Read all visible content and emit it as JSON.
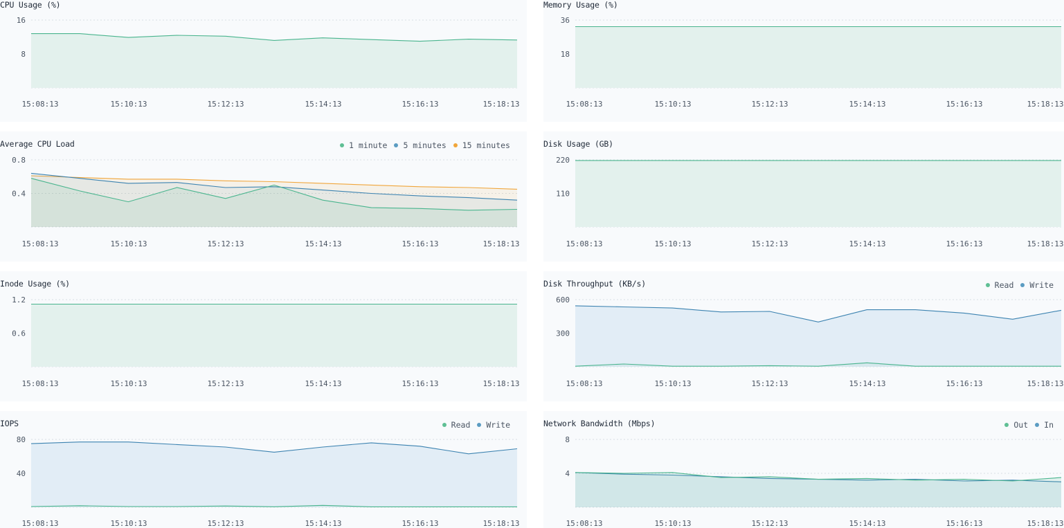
{
  "chart_data": [
    {
      "id": "cpu",
      "type": "area",
      "title": "CPU Usage (%)",
      "yticks": [
        "16",
        "8"
      ],
      "ylim": [
        0,
        16
      ],
      "xticks": [
        "15:08:13",
        "15:10:13",
        "15:12:13",
        "15:14:13",
        "15:16:13",
        "15:18:13"
      ],
      "grid": true,
      "series": [
        {
          "color": "#48b48d",
          "fill": "#e3f1ed",
          "values": [
            12.8,
            12.8,
            11.9,
            12.4,
            12.2,
            11.2,
            11.8,
            11.4,
            11.0,
            11.5,
            11.3
          ]
        }
      ]
    },
    {
      "id": "mem",
      "type": "area",
      "title": "Memory Usage (%)",
      "yticks": [
        "36",
        "18"
      ],
      "ylim": [
        0,
        36
      ],
      "xticks": [
        "15:08:13",
        "15:10:13",
        "15:12:13",
        "15:14:13",
        "15:16:13",
        "15:18:13"
      ],
      "grid": true,
      "series": [
        {
          "color": "#48b48d",
          "fill": "#e3f1ed",
          "values": [
            32.5,
            32.5,
            32.5,
            32.5,
            32.5,
            32.5,
            32.5,
            32.5,
            32.5,
            32.5,
            32.5
          ]
        }
      ]
    },
    {
      "id": "load",
      "type": "area",
      "title": "Average CPU Load",
      "yticks": [
        "0.8",
        "0.4"
      ],
      "ylim": [
        0,
        0.8
      ],
      "xticks": [
        "15:08:13",
        "15:10:13",
        "15:12:13",
        "15:14:13",
        "15:16:13",
        "15:18:13"
      ],
      "grid": true,
      "legend": [
        {
          "label": "1 minute",
          "color": "#5fbf94"
        },
        {
          "label": "5 minutes",
          "color": "#5b9cc2"
        },
        {
          "label": "15 minutes",
          "color": "#f0a53a"
        }
      ],
      "series": [
        {
          "name": "15 minutes",
          "color": "#f0a53a",
          "fill": "rgba(240,165,58,0.10)",
          "values": [
            0.61,
            0.59,
            0.57,
            0.57,
            0.55,
            0.54,
            0.52,
            0.5,
            0.48,
            0.47,
            0.45
          ]
        },
        {
          "name": "5 minutes",
          "color": "#3b82b0",
          "fill": "rgba(91,156,194,0.10)",
          "values": [
            0.64,
            0.58,
            0.52,
            0.53,
            0.47,
            0.48,
            0.44,
            0.4,
            0.37,
            0.35,
            0.32
          ]
        },
        {
          "name": "1 minute",
          "color": "#48b48d",
          "fill": "rgba(72,180,141,0.10)",
          "values": [
            0.58,
            0.43,
            0.3,
            0.47,
            0.34,
            0.5,
            0.32,
            0.23,
            0.22,
            0.2,
            0.21
          ]
        }
      ]
    },
    {
      "id": "disk",
      "type": "area",
      "title": "Disk Usage (GB)",
      "yticks": [
        "220",
        "110"
      ],
      "ylim": [
        0,
        220
      ],
      "xticks": [
        "15:08:13",
        "15:10:13",
        "15:12:13",
        "15:14:13",
        "15:16:13",
        "15:18:13"
      ],
      "grid": true,
      "series": [
        {
          "color": "#48b48d",
          "fill": "#e3f1ed",
          "values": [
            218,
            218,
            218,
            218,
            218,
            218,
            218,
            218,
            218,
            218,
            218
          ]
        }
      ]
    },
    {
      "id": "inode",
      "type": "area",
      "title": "Inode Usage (%)",
      "yticks": [
        "1.2",
        "0.6"
      ],
      "ylim": [
        0,
        1.2
      ],
      "xticks": [
        "15:08:13",
        "15:10:13",
        "15:12:13",
        "15:14:13",
        "15:16:13",
        "15:18:13"
      ],
      "grid": true,
      "series": [
        {
          "color": "#48b48d",
          "fill": "#e3f1ed",
          "values": [
            1.12,
            1.12,
            1.12,
            1.12,
            1.12,
            1.12,
            1.12,
            1.12,
            1.12,
            1.12,
            1.12
          ]
        }
      ]
    },
    {
      "id": "thru",
      "type": "area",
      "title": "Disk Throughput (KB/s)",
      "yticks": [
        "600",
        "300"
      ],
      "ylim": [
        0,
        600
      ],
      "xticks": [
        "15:08:13",
        "15:10:13",
        "15:12:13",
        "15:14:13",
        "15:16:13",
        "15:18:13"
      ],
      "grid": true,
      "legend": [
        {
          "label": "Read",
          "color": "#5fbf94"
        },
        {
          "label": "Write",
          "color": "#5b9cc2"
        }
      ],
      "series": [
        {
          "name": "Write",
          "color": "#3b82b0",
          "fill": "#e2edf6",
          "values": [
            545,
            535,
            525,
            490,
            495,
            400,
            510,
            510,
            480,
            425,
            505
          ]
        },
        {
          "name": "Read",
          "color": "#48b48d",
          "fill": "rgba(72,180,141,0.08)",
          "values": [
            5,
            25,
            5,
            5,
            10,
            5,
            35,
            5,
            5,
            5,
            5
          ]
        }
      ]
    },
    {
      "id": "iops",
      "type": "area",
      "title": "IOPS",
      "yticks": [
        "80",
        "40"
      ],
      "ylim": [
        0,
        80
      ],
      "xticks": [
        "15:08:13",
        "15:10:13",
        "15:12:13",
        "15:14:13",
        "15:16:13",
        "15:18:13"
      ],
      "grid": true,
      "legend": [
        {
          "label": "Read",
          "color": "#5fbf94"
        },
        {
          "label": "Write",
          "color": "#5b9cc2"
        }
      ],
      "series": [
        {
          "name": "Write",
          "color": "#3b82b0",
          "fill": "#e2edf6",
          "values": [
            75,
            77,
            77,
            74,
            71,
            65,
            71,
            76,
            72,
            63,
            69
          ]
        },
        {
          "name": "Read",
          "color": "#48b48d",
          "fill": "rgba(72,180,141,0.08)",
          "values": [
            0.8,
            1.8,
            0.8,
            0.8,
            1.5,
            0.6,
            2.2,
            0.5,
            0.5,
            0.5,
            0.5
          ]
        }
      ]
    },
    {
      "id": "net",
      "type": "area",
      "title": "Network Bandwidth (Mbps)",
      "yticks": [
        "8",
        "4"
      ],
      "ylim": [
        0,
        8
      ],
      "xticks": [
        "15:08:13",
        "15:10:13",
        "15:12:13",
        "15:14:13",
        "15:16:13",
        "15:18:13"
      ],
      "grid": true,
      "legend": [
        {
          "label": "Out",
          "color": "#5fbf94"
        },
        {
          "label": "In",
          "color": "#5b9cc2"
        }
      ],
      "series": [
        {
          "name": "In",
          "color": "#3b82b0",
          "fill": "rgba(91,156,194,0.12)",
          "values": [
            4.1,
            3.9,
            3.8,
            3.6,
            3.4,
            3.3,
            3.2,
            3.3,
            3.1,
            3.2,
            3.0
          ]
        },
        {
          "name": "Out",
          "color": "#48b48d",
          "fill": "rgba(72,180,141,0.12)",
          "values": [
            4.1,
            4.0,
            4.1,
            3.5,
            3.6,
            3.3,
            3.4,
            3.2,
            3.3,
            3.1,
            3.5
          ]
        }
      ]
    }
  ]
}
